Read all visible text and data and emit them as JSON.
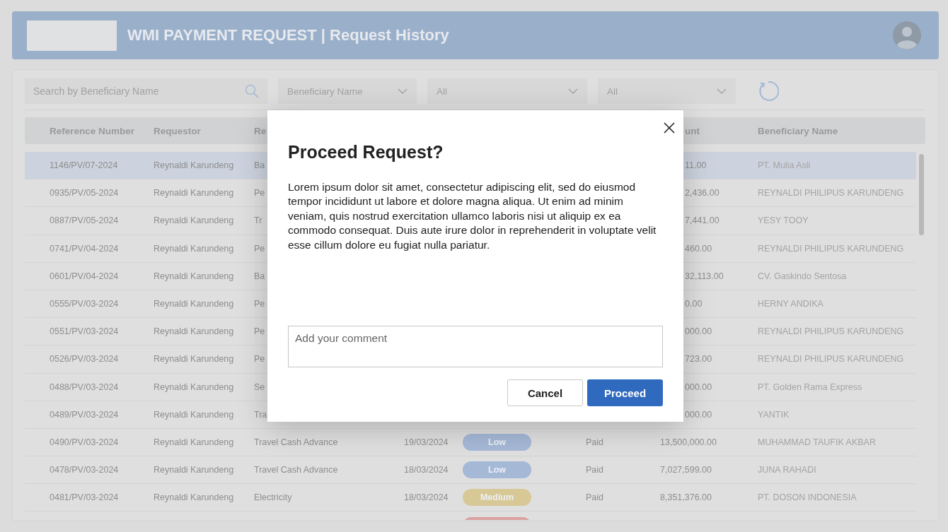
{
  "header": {
    "title": "WMI PAYMENT REQUEST | Request History"
  },
  "filters": {
    "search": {
      "placeholder": "Search by Beneficiary Name"
    },
    "dropdowns": [
      {
        "value": "Beneficiary Name"
      },
      {
        "value": "All"
      },
      {
        "value": "All"
      }
    ]
  },
  "table": {
    "columns": {
      "reference_number": "Reference Number",
      "requestor": "Requestor",
      "column_3": "Re",
      "column_7": "unt",
      "beneficiary_name": "Beneficiary Name"
    },
    "rows": [
      {
        "selected": true,
        "reference": "1146/PV/07-2024",
        "requestor": "Reynaldi Karundeng",
        "column_3": "Ba",
        "amount": "11.00",
        "beneficiary": "PT. Mulia Asli"
      },
      {
        "selected": false,
        "reference": "0935/PV/05-2024",
        "requestor": "Reynaldi Karundeng",
        "column_3": "Pe",
        "amount": "2,436.00",
        "beneficiary": "REYNALDI PHILIPUS KARUNDENG"
      },
      {
        "selected": false,
        "reference": "0887/PV/05-2024",
        "requestor": "Reynaldi Karundeng",
        "column_3": "Tr",
        "amount": "7,441.00",
        "beneficiary": "YESY TOOY"
      },
      {
        "selected": false,
        "reference": "0741/PV/04-2024",
        "requestor": "Reynaldi Karundeng",
        "column_3": "Pe",
        "amount": "460.00",
        "beneficiary": "REYNALDI PHILIPUS KARUNDENG"
      },
      {
        "selected": false,
        "reference": "0601/PV/04-2024",
        "requestor": "Reynaldi Karundeng",
        "column_3": "Ba",
        "amount": "32,113.00",
        "beneficiary": "CV. Gaskindo Sentosa"
      },
      {
        "selected": false,
        "reference": "0555/PV/03-2024",
        "requestor": "Reynaldi Karundeng",
        "column_3": "Pe",
        "amount": "0.00",
        "beneficiary": "HERNY ANDIKA"
      },
      {
        "selected": false,
        "reference": "0551/PV/03-2024",
        "requestor": "Reynaldi Karundeng",
        "column_3": "Pe",
        "amount": "000.00",
        "beneficiary": "REYNALDI PHILIPUS KARUNDENG"
      },
      {
        "selected": false,
        "reference": "0526/PV/03-2024",
        "requestor": "Reynaldi Karundeng",
        "column_3": "Pe",
        "amount": "723.00",
        "beneficiary": "REYNALDI PHILIPUS KARUNDENG"
      },
      {
        "selected": false,
        "reference": "0488/PV/03-2024",
        "requestor": "Reynaldi Karundeng",
        "column_3": "Se",
        "amount": "000.00",
        "beneficiary": "PT. Golden Rama Express"
      },
      {
        "selected": false,
        "reference": "0489/PV/03-2024",
        "requestor": "Reynaldi Karundeng",
        "column_3": "Tra",
        "amount": "000.00",
        "beneficiary": "YANTIK"
      },
      {
        "selected": false,
        "reference": "0490/PV/03-2024",
        "requestor": "Reynaldi Karundeng",
        "column_3": "Travel Cash Advance",
        "date": "19/03/2024",
        "tag": {
          "label": "Low",
          "color": "#a5b8d6"
        },
        "status": "Paid",
        "amount": "13,500,000.00",
        "beneficiary": "MUHAMMAD TAUFIK AKBAR"
      },
      {
        "selected": false,
        "reference": "0478/PV/03-2024",
        "requestor": "Reynaldi Karundeng",
        "column_3": "Travel Cash Advance",
        "date": "18/03/2024",
        "tag": {
          "label": "Low",
          "color": "#a5b8d6"
        },
        "status": "Paid",
        "amount": "7,027,599.00",
        "beneficiary": "JUNA RAHADI"
      },
      {
        "selected": false,
        "reference": "0481/PV/03-2024",
        "requestor": "Reynaldi Karundeng",
        "column_3": "Electricity",
        "date": "18/03/2024",
        "tag": {
          "label": "Medium",
          "color": "#d8c896"
        },
        "status": "Paid",
        "amount": "8,351,376.00",
        "beneficiary": "PT. DOSON INDONESIA"
      },
      {
        "selected": false,
        "tag": {
          "color": "#dba0a0"
        }
      }
    ]
  },
  "dialog": {
    "title": "Proceed Request?",
    "message": "Lorem ipsum dolor sit amet, consectetur adipiscing elit, sed do eiusmod tempor incididunt ut labore et dolore magna aliqua. Ut enim ad minim veniam, quis nostrud exercitation ullamco laboris nisi ut aliquip ex ea commodo consequat. Duis aute irure dolor in reprehenderit in voluptate velit esse cillum dolore eu fugiat nulla pariatur.",
    "comment": {
      "placeholder": "Add your comment"
    },
    "buttons": [
      {
        "label": "Cancel",
        "kind": "secondary"
      },
      {
        "label": "Proceed",
        "kind": "primary"
      }
    ]
  }
}
